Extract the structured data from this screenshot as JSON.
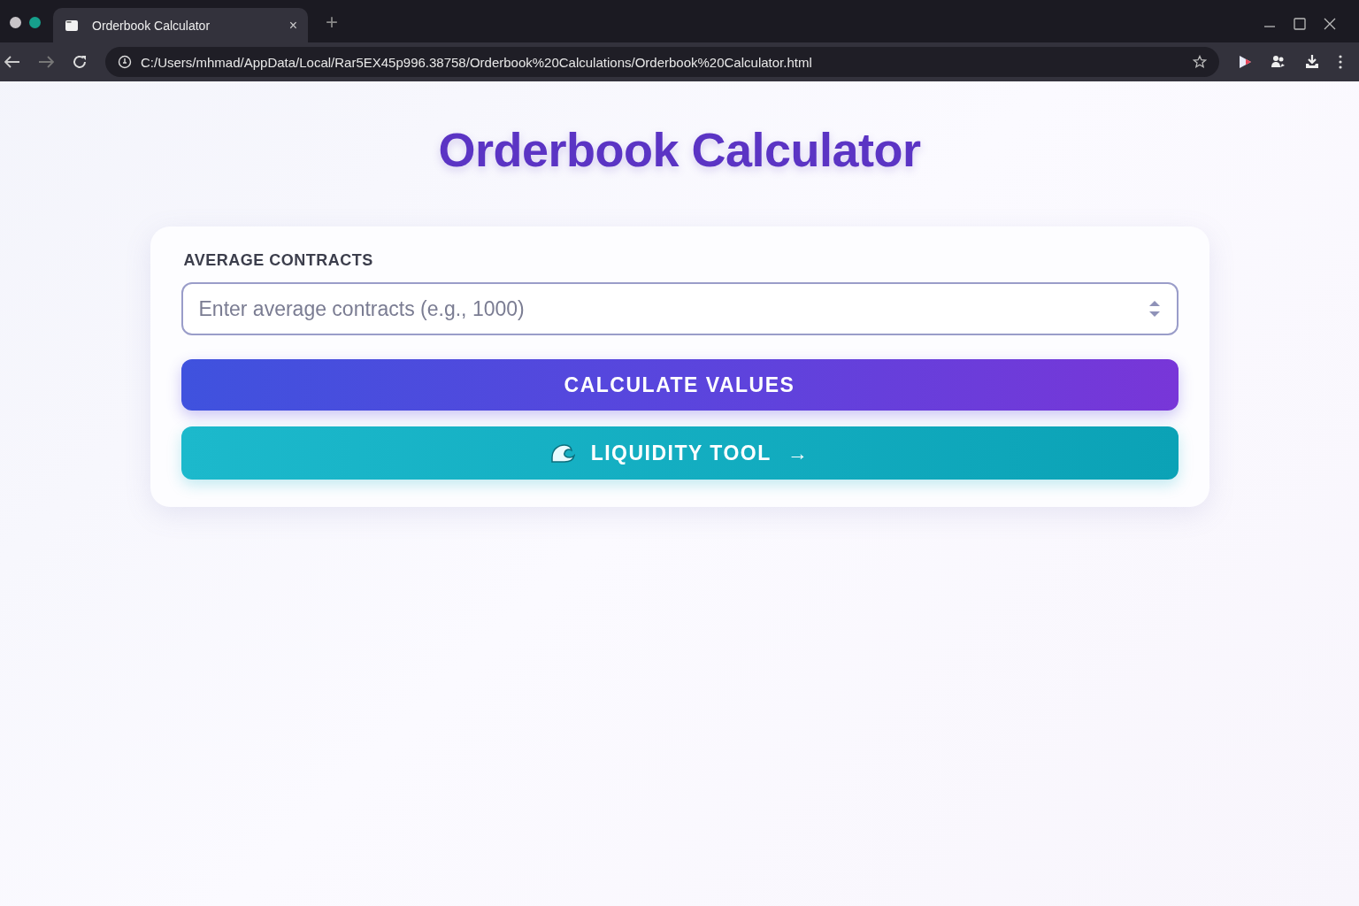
{
  "browser": {
    "tabs": [
      {
        "title": "Orderbook Calculator",
        "close": "×",
        "selected": true
      }
    ],
    "new_tab": "+",
    "address": "C:/Users/mhmad/AppData/Local/Rar5EX45p996.38758/Orderbook%20Calculations/Orderbook%20Calculator.html"
  },
  "page": {
    "title": "Orderbook Calculator",
    "field_label": "AVERAGE CONTRACTS",
    "field_placeholder": "Enter average contracts (e.g., 1000)",
    "buttons": [
      {
        "kind": "primary",
        "label": "CALCULATE VALUES"
      },
      {
        "kind": "link",
        "label": "LIQUIDITY TOOL",
        "arrow": "→"
      }
    ]
  }
}
